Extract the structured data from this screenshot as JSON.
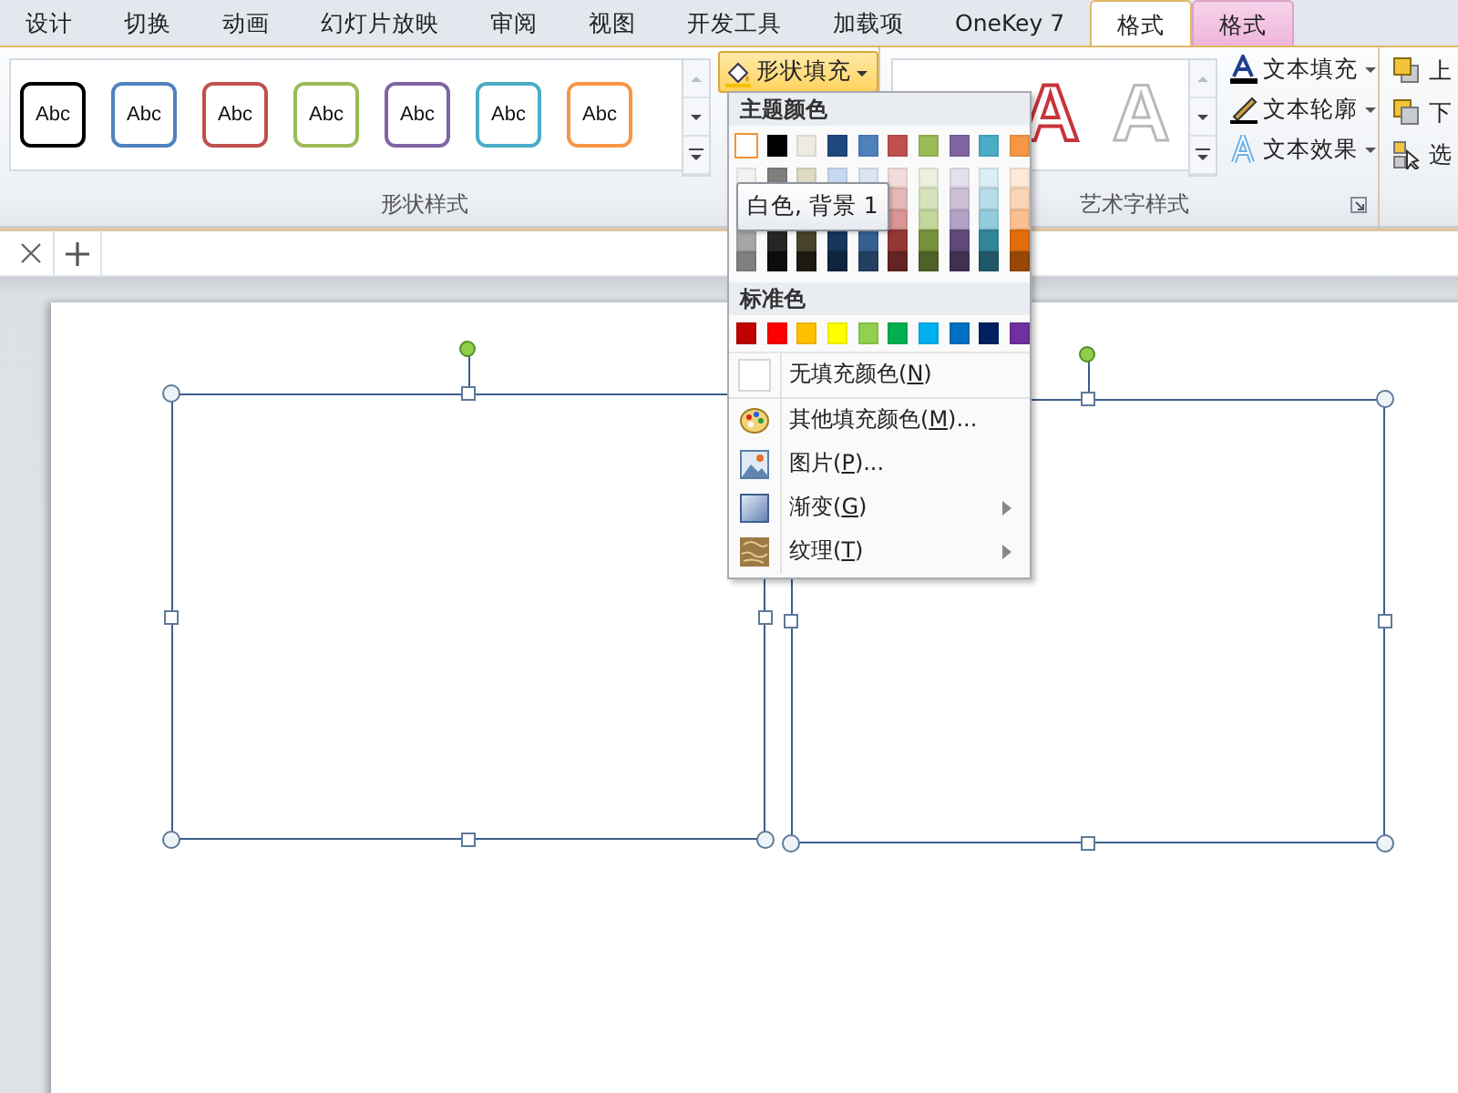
{
  "ribbon_tabs": [
    {
      "label": "设计",
      "selected": false,
      "kind": "normal"
    },
    {
      "label": "切换",
      "selected": false,
      "kind": "normal"
    },
    {
      "label": "动画",
      "selected": false,
      "kind": "normal"
    },
    {
      "label": "幻灯片放映",
      "selected": false,
      "kind": "normal"
    },
    {
      "label": "审阅",
      "selected": false,
      "kind": "normal"
    },
    {
      "label": "视图",
      "selected": false,
      "kind": "normal"
    },
    {
      "label": "开发工具",
      "selected": false,
      "kind": "normal"
    },
    {
      "label": "加载项",
      "selected": false,
      "kind": "normal"
    },
    {
      "label": "OneKey 7",
      "selected": false,
      "kind": "normal"
    },
    {
      "label": "格式",
      "selected": true,
      "kind": "normal"
    },
    {
      "label": "格式",
      "selected": false,
      "kind": "contextual"
    }
  ],
  "shape_styles": {
    "label": "形状样式",
    "items": [
      {
        "text": "Abc",
        "color": "#000000"
      },
      {
        "text": "Abc",
        "color": "#4f81bd"
      },
      {
        "text": "Abc",
        "color": "#c0504d"
      },
      {
        "text": "Abc",
        "color": "#9bbb59"
      },
      {
        "text": "Abc",
        "color": "#8064a2"
      },
      {
        "text": "Abc",
        "color": "#4bacc6"
      },
      {
        "text": "Abc",
        "color": "#f79646"
      }
    ]
  },
  "shape_fill_button": {
    "label": "形状填充",
    "expanded": true
  },
  "wordart_styles": {
    "label": "艺术字样式",
    "samples": [
      {
        "text": "A",
        "kind": "red-outline"
      },
      {
        "text": "A",
        "kind": "white-outline"
      }
    ],
    "buttons": [
      {
        "label": "文本填充",
        "kind": "fill"
      },
      {
        "label": "文本轮廓",
        "kind": "outline"
      },
      {
        "label": "文本效果",
        "kind": "effects"
      }
    ]
  },
  "arrange": {
    "buttons": [
      {
        "label": "上",
        "kind": "bring-forward"
      },
      {
        "label": "下",
        "kind": "send-backward"
      },
      {
        "label": "选",
        "kind": "selection"
      }
    ]
  },
  "fill_menu": {
    "theme_heading": "主题颜色",
    "theme_rows": [
      [
        {
          "color": "#ffffff",
          "selected": true
        },
        {
          "color": "#000000",
          "selected": false
        },
        {
          "color": "#eeece1",
          "selected": false
        },
        {
          "color": "#1f497d",
          "selected": false
        },
        {
          "color": "#4f81bd",
          "selected": false
        },
        {
          "color": "#c0504d",
          "selected": false
        },
        {
          "color": "#9bbb59",
          "selected": false
        },
        {
          "color": "#8064a2",
          "selected": false
        },
        {
          "color": "#4bacc6",
          "selected": false
        },
        {
          "color": "#f79646",
          "selected": false
        }
      ],
      [
        {
          "color": "#f2f2f2",
          "selected": false
        },
        {
          "color": "#7f7f7f",
          "selected": false
        },
        {
          "color": "#ddd9c3",
          "selected": false
        },
        {
          "color": "#c6d9f0",
          "selected": false
        },
        {
          "color": "#dbe5f1",
          "selected": false
        },
        {
          "color": "#f2dcdb",
          "selected": false
        },
        {
          "color": "#ebf1dd",
          "selected": false
        },
        {
          "color": "#e5e0ec",
          "selected": false
        },
        {
          "color": "#dbeef3",
          "selected": false
        },
        {
          "color": "#fdeada",
          "selected": false
        }
      ],
      [
        null,
        null,
        null,
        null,
        null,
        {
          "color": "#e5b9b7",
          "selected": false
        },
        {
          "color": "#d7e3bc",
          "selected": false
        },
        {
          "color": "#ccc1d9",
          "selected": false
        },
        {
          "color": "#b7dde8",
          "selected": false
        },
        {
          "color": "#fbd5b5",
          "selected": false
        }
      ],
      [
        null,
        null,
        null,
        null,
        null,
        {
          "color": "#d99694",
          "selected": false
        },
        {
          "color": "#c3d69b",
          "selected": false
        },
        {
          "color": "#b2a2c7",
          "selected": false
        },
        {
          "color": "#92cddc",
          "selected": false
        },
        {
          "color": "#fac08f",
          "selected": false
        }
      ],
      [
        {
          "color": "#a6a6a6",
          "selected": false
        },
        {
          "color": "#262626",
          "selected": false
        },
        {
          "color": "#494429",
          "selected": false
        },
        {
          "color": "#17365d",
          "selected": false
        },
        {
          "color": "#366092",
          "selected": false
        },
        {
          "color": "#953734",
          "selected": false
        },
        {
          "color": "#76923c",
          "selected": false
        },
        {
          "color": "#5f497a",
          "selected": false
        },
        {
          "color": "#31859b",
          "selected": false
        },
        {
          "color": "#e36c09",
          "selected": false
        }
      ],
      [
        {
          "color": "#808080",
          "selected": false
        },
        {
          "color": "#0d0d0d",
          "selected": false
        },
        {
          "color": "#1d1b10",
          "selected": false
        },
        {
          "color": "#0f243e",
          "selected": false
        },
        {
          "color": "#244061",
          "selected": false
        },
        {
          "color": "#632423",
          "selected": false
        },
        {
          "color": "#4f6128",
          "selected": false
        },
        {
          "color": "#3f3151",
          "selected": false
        },
        {
          "color": "#205867",
          "selected": false
        },
        {
          "color": "#974806",
          "selected": false
        }
      ]
    ],
    "tooltip": "白色, 背景 1",
    "standard_heading": "标准色",
    "standard_colors": [
      {
        "color": "#c00000",
        "selected": false
      },
      {
        "color": "#ff0000",
        "selected": false
      },
      {
        "color": "#ffc000",
        "selected": false
      },
      {
        "color": "#ffff00",
        "selected": false
      },
      {
        "color": "#92d050",
        "selected": false
      },
      {
        "color": "#00b050",
        "selected": false
      },
      {
        "color": "#00b0f0",
        "selected": false
      },
      {
        "color": "#0070c0",
        "selected": false
      },
      {
        "color": "#002060",
        "selected": false
      },
      {
        "color": "#7030a0",
        "selected": false
      }
    ],
    "items": [
      {
        "kind": "no-fill",
        "before": "无填充颜色(",
        "key": "N",
        "after": ")",
        "submenu": false
      },
      {
        "kind": "more-colors",
        "before": "其他填充颜色(",
        "key": "M",
        "after": ")...",
        "submenu": false
      },
      {
        "kind": "picture",
        "before": "图片(",
        "key": "P",
        "after": ")...",
        "submenu": false
      },
      {
        "kind": "gradient",
        "before": "渐变(",
        "key": "G",
        "after": ")",
        "submenu": true
      },
      {
        "kind": "texture",
        "before": "纹理(",
        "key": "T",
        "after": ")",
        "submenu": true
      }
    ]
  },
  "slide": {
    "shapes": [
      {
        "kind": "rectangle",
        "selected": true
      },
      {
        "kind": "rectangle",
        "selected": true
      }
    ]
  }
}
